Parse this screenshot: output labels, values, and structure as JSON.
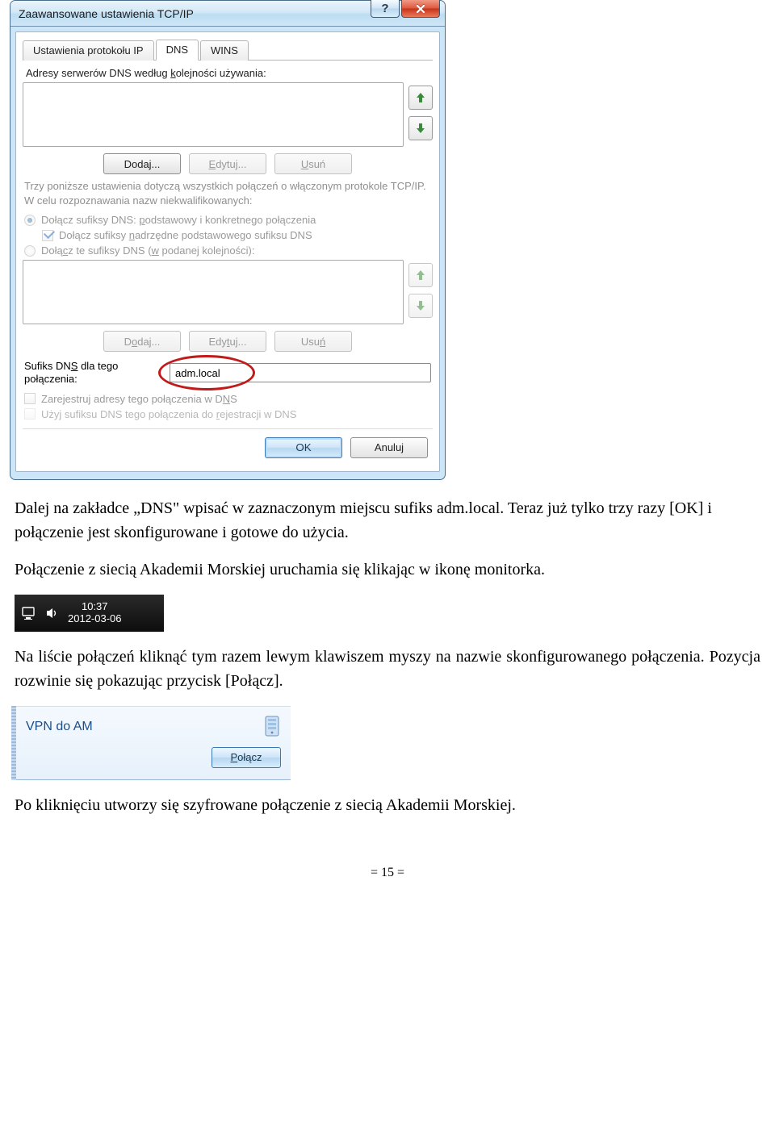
{
  "dialog": {
    "title": "Zaawansowane ustawienia TCP/IP",
    "tabs": {
      "ip": "Ustawienia protokołu IP",
      "dns": "DNS",
      "wins": "WINS"
    },
    "dns_servers_label_pre": "Adresy serwerów DNS według ",
    "dns_servers_label_hot": "k",
    "dns_servers_label_post": "olejności używania:",
    "buttons": {
      "add": "Dodaj...",
      "edit_pre": "",
      "edit_hot": "E",
      "edit_post": "dytuj...",
      "remove_pre": "",
      "remove_hot": "U",
      "remove_post": "suń",
      "add2_pre": "D",
      "add2_hot": "o",
      "add2_post": "daj...",
      "edit2_pre": "Edy",
      "edit2_hot": "t",
      "edit2_post": "uj...",
      "remove2_pre": "Usu",
      "remove2_hot": "ń",
      "remove2_post": ""
    },
    "explain": "Trzy poniższe ustawienia dotyczą wszystkich połączeń o włączonym protokole TCP/IP. W celu rozpoznawania nazw niekwalifikowanych:",
    "radio1_pre": "Dołącz sufiksy DNS: ",
    "radio1_hot": "p",
    "radio1_post": "odstawowy i konkretnego połączenia",
    "check_parent_pre": "Dołącz sufiksy ",
    "check_parent_hot": "n",
    "check_parent_post": "adrzędne podstawowego sufiksu DNS",
    "radio2_pre": "Dołą",
    "radio2_hot": "c",
    "radio2_mid": "z te sufiksy DNS (",
    "radio2_hot2": "w",
    "radio2_post": " podanej kolejności):",
    "suffix_label_pre": "Sufiks DN",
    "suffix_label_hot": "S",
    "suffix_label_post": " dla tego połączenia:",
    "suffix_value": "adm.local",
    "check_register_pre": "Zarejestruj adresy tego połączenia w D",
    "check_register_hot": "N",
    "check_register_post": "S",
    "check_usesuffix_pre": "Użyj sufiksu DNS tego połączenia do ",
    "check_usesuffix_hot": "r",
    "check_usesuffix_post": "ejestracji w DNS",
    "ok": "OK",
    "cancel": "Anuluj"
  },
  "doc": {
    "p1": "Dalej na zakładce „DNS\" wpisać w zaznaczonym miejscu sufiks adm.local. Teraz już tylko trzy razy [OK] i połączenie jest skonfigurowane i gotowe do użycia.",
    "p2": "Połączenie z siecią Akademii Morskiej uruchamia się klikając w ikonę monitorka.",
    "p3": "Na liście połączeń kliknąć tym razem lewym klawiszem myszy na nazwie skonfigurowanego połączenia. Pozycja rozwinie się pokazując przycisk [Połącz].",
    "p4": "Po kliknięciu utworzy się szyfrowane połączenie z siecią Akademii Morskiej."
  },
  "tray": {
    "time": "10:37",
    "date": "2012-03-06"
  },
  "flyout": {
    "title": "VPN do AM",
    "connect_pre": "",
    "connect_hot": "P",
    "connect_post": "ołącz"
  },
  "page": "= 15 ="
}
